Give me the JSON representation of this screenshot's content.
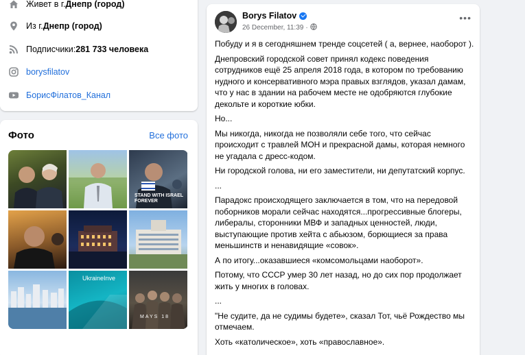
{
  "intro": {
    "lives_prefix": "Живет в г. ",
    "lives_city": "Днепр (город)",
    "from_prefix": "Из г. ",
    "from_city": "Днепр (город)",
    "followers_prefix": "Подписчики: ",
    "followers_count": "281 733 человека",
    "instagram": "borysfilatov",
    "youtube": "БорисФілатов_Канал"
  },
  "photos": {
    "title": "Фото",
    "see_all": "Все фото",
    "items": [
      {
        "caption": ""
      },
      {
        "caption": ""
      },
      {
        "caption": "STAND WITH ISRAEL FOREVER"
      },
      {
        "caption": ""
      },
      {
        "caption": ""
      },
      {
        "caption": ""
      },
      {
        "caption": ""
      },
      {
        "caption": "UkraineInve"
      },
      {
        "caption": "MAYS 18"
      }
    ]
  },
  "post": {
    "author": "Borys Filatov",
    "date": "26 December, 11:39",
    "paragraphs": [
      "Побуду и я в сегодняшнем тренде соцсетей ( а, вернее, наоборот ).",
      "Днепровский городской совет принял кодекс поведения сотрудников ещё 25 апреля 2018 года, в котором по требованию нудного и консервативного мэра правых взглядов, указал дамам, что у нас в здании на рабочем месте не одобряются глубокие декольте и короткие юбки.",
      "Но...",
      "Мы никогда, никогда не позволяли себе того, что сейчас происходит с травлей МОН и прекрасной дамы, которая немного не угадала с дресс-кодом.",
      "Ни городской голова, ни его заместители, ни депутатский корпус.",
      "...",
      "Парадокс происходящего заключается в том, что на передовой поборников морали сейчас находятся...прогрессивные блогеры, либералы, сторонники МВФ и западных ценностей, люди, выступающие против хейта с абьюзом, борющиеся за права меньшинств и ненавидящие «совок».",
      "А по итогу...оказавшиеся «комсомольцами наоборот».",
      "Потому, что СССР умер 30 лет назад, но до сих пор продолжает жить у многих в головах.",
      "...",
      "\"Не судите, да не судимы будете», сказал Тот, чьё Рождество мы отмечаем.",
      "Хоть «католическое», хоть «православное»."
    ]
  }
}
